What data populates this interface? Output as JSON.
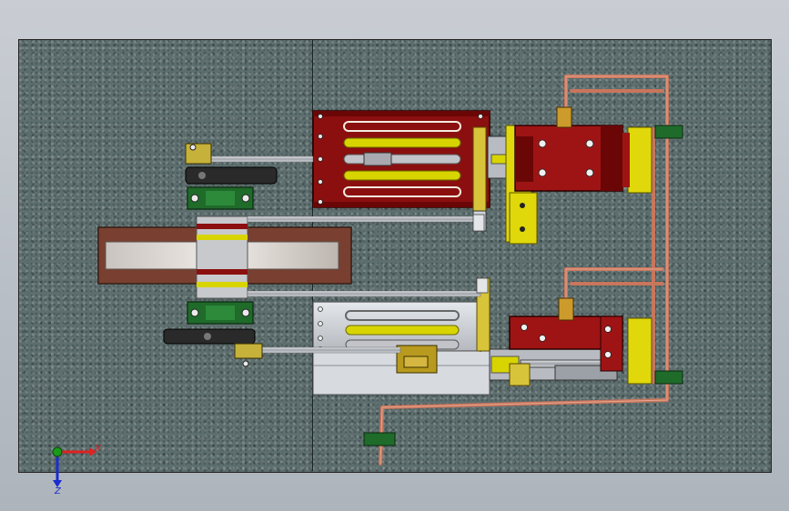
{
  "viewport": {
    "background_colors": [
      "#c9cdd3",
      "#aeb4bc"
    ],
    "baseplate_color": "#5d6e6e"
  },
  "model": {
    "palette": {
      "cylinder_red": "#8b0f0f",
      "steam_chest_red": "#9e1414",
      "brass_yellow": "#d8d400",
      "bracket_yellow": "#e0d80a",
      "bearing_green": "#1f6b2a",
      "copper_pipe": "#c8765c",
      "steel": "#b9bcc2",
      "cylinder_silver": "#cfd3d9",
      "flywheel_marble": "#8a4a3a",
      "dark_metal": "#2a2a2a"
    }
  },
  "triad": {
    "x_label": "X",
    "z_label": "Z",
    "x_color": "#d22",
    "y_color": "#1a9a1a",
    "z_color": "#1a2bd0"
  }
}
